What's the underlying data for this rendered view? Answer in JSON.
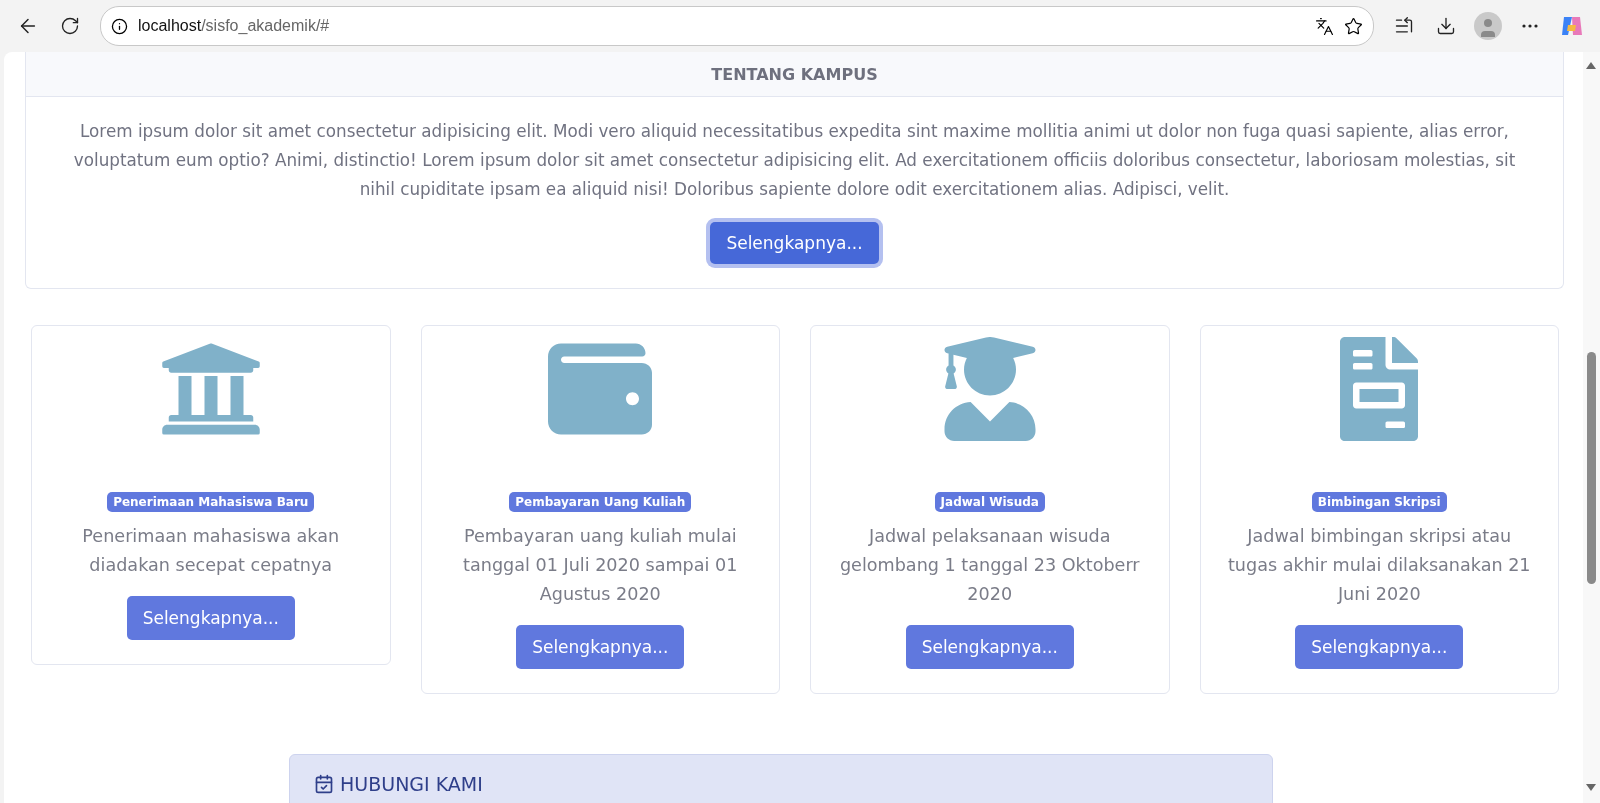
{
  "browser": {
    "url_host": "localhost",
    "url_path": "/sisfo_akademik/#"
  },
  "about": {
    "title": "TENTANG KAMPUS",
    "text": "Lorem ipsum dolor sit amet consectetur adipisicing elit. Modi vero aliquid necessitatibus expedita sint maxime mollitia animi ut dolor non fuga quasi sapiente, alias error, voluptatum eum optio? Animi, distinctio! Lorem ipsum dolor sit amet consectetur adipisicing elit. Ad exercitationem officiis doloribus consectetur, laboriosam molestias, sit nihil cupiditate ipsam ea aliquid nisi! Doloribus sapiente dolore odit exercitationem alias. Adipisci, velit.",
    "button": "Selengkapnya..."
  },
  "services": [
    {
      "kind": "bank",
      "badge": "Penerimaan Mahasiswa Baru",
      "text": "Penerimaan mahasiswa akan diadakan secepat cepatnya",
      "button": "Selengkapnya..."
    },
    {
      "kind": "wallet",
      "badge": "Pembayaran Uang Kuliah",
      "text": "Pembayaran uang kuliah mulai tanggal 01 Juli 2020 sampai 01 Agustus 2020",
      "button": "Selengkapnya..."
    },
    {
      "kind": "graduate",
      "badge": "Jadwal Wisuda",
      "text": "Jadwal pelaksanaan wisuda gelombang 1 tanggal 23 Oktoberr 2020",
      "button": "Selengkapnya..."
    },
    {
      "kind": "document",
      "badge": "Bimbingan Skripsi",
      "text": "Jadwal bimbingan skripsi atau tugas akhir mulai dilaksanakan 21 Juni 2020",
      "button": "Selengkapnya..."
    }
  ],
  "contact": {
    "title": "HUBUNGI KAMI"
  }
}
